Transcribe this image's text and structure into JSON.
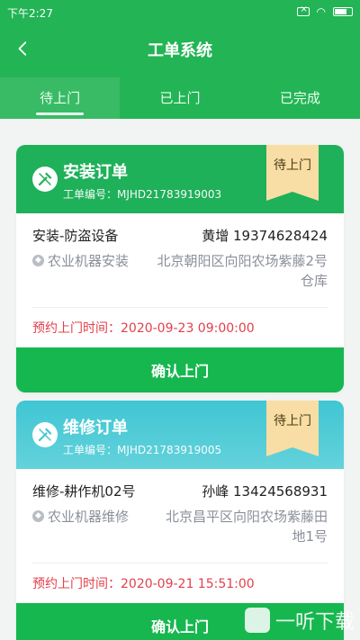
{
  "status_bar": {
    "time": "下午2:27"
  },
  "header": {
    "title": "工单系统"
  },
  "tabs": [
    {
      "label": "待上门",
      "active": true
    },
    {
      "label": "已上门",
      "active": false
    },
    {
      "label": "已完成",
      "active": false
    }
  ],
  "orders": [
    {
      "type_title": "安装订单",
      "order_no": "工单编号：MJHD21783919003",
      "status": "待上门",
      "service": "安装-防盗设备",
      "contact": "黄增 19374628424",
      "category": "农业机器安装",
      "address": "北京朝阳区向阳农场紫藤2号仓库",
      "appointment": "预约上门时间：2020-09-23 09:00:00",
      "confirm_label": "确认上门",
      "header_color": "#1fb05a"
    },
    {
      "type_title": "维修订单",
      "order_no": "工单编号：MJHD21783919005",
      "status": "待上门",
      "service": "维修-耕作机02号",
      "contact": "孙峰 13424568931",
      "category": "农业机器维修",
      "address": "北京昌平区向阳农场紫藤田地1号",
      "appointment": "预约上门时间：2020-09-21 15:51:00",
      "confirm_label": "确认上门",
      "header_color": "#3fc6d3"
    }
  ],
  "watermark": {
    "text": "一听下载"
  },
  "colors": {
    "primary": "#23b455",
    "badge": "#f8dea5",
    "appointment": "#e2404b"
  }
}
